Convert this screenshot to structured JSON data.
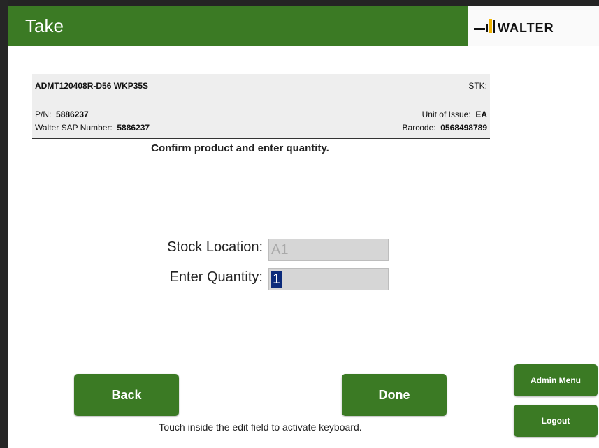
{
  "header": {
    "title": "Take",
    "logo_text": "WALTER"
  },
  "product": {
    "name": "ADMT120408R-D56 WKP35S",
    "stk_label": "STK:",
    "pn_label": "P/N:",
    "pn_value": "5886237",
    "sap_label": "Walter SAP Number:",
    "sap_value": "5886237",
    "uoi_label": "Unit of Issue:",
    "uoi_value": "EA",
    "barcode_label": "Barcode:",
    "barcode_value": "0568498789"
  },
  "instruction": "Confirm product and enter quantity.",
  "form": {
    "stock_location_label": "Stock Location:",
    "stock_location_value": "A1",
    "quantity_label": "Enter Quantity:",
    "quantity_value": "1"
  },
  "buttons": {
    "back": "Back",
    "done": "Done",
    "admin_menu": "Admin Menu",
    "logout": "Logout"
  },
  "hint": "Touch inside the edit field to activate keyboard.",
  "colors": {
    "brand_green": "#3b7a24",
    "background": "#ffffff"
  }
}
